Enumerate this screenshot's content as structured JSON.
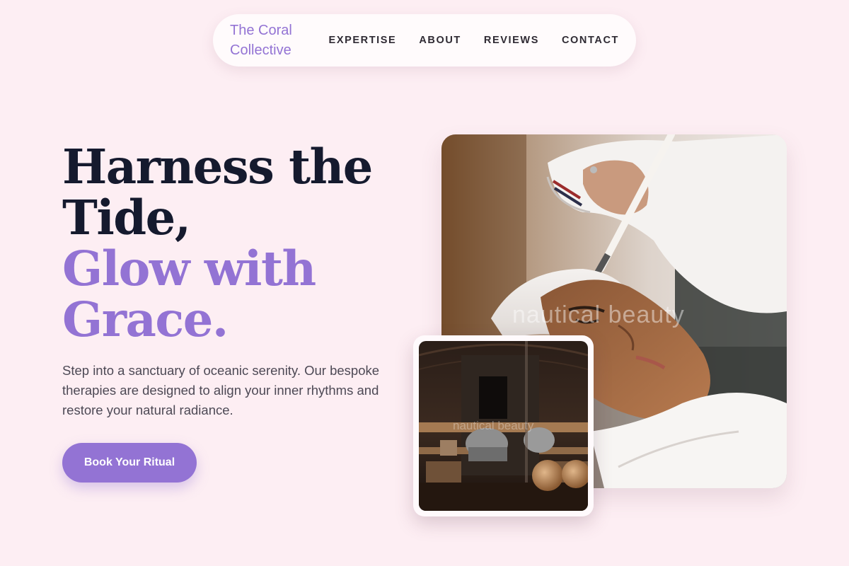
{
  "nav": {
    "brand": "The Coral Collective",
    "links": [
      "EXPERTISE",
      "ABOUT",
      "REVIEWS",
      "CONTACT"
    ]
  },
  "hero": {
    "headline_line1": "Harness the",
    "headline_line2": "Tide,",
    "headline_accent_line1": "Glow with",
    "headline_accent_line2": "Grace.",
    "description": "Step into a sanctuary of oceanic serenity. Our bespoke therapies are designed to align your inner rhythms and restore your natural radiance.",
    "cta_label": "Book Your Ritual"
  },
  "images": {
    "main_watermark": "nautical beauty",
    "inset_watermark": "nautical beauty"
  },
  "colors": {
    "background": "#fdeef3",
    "accent": "#9373d4",
    "heading": "#151a2e"
  }
}
